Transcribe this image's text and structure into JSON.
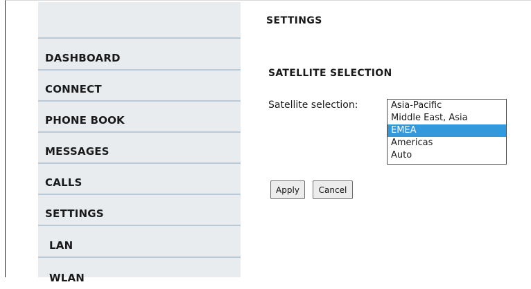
{
  "sidebar": {
    "items": [
      {
        "label": "DASHBOARD"
      },
      {
        "label": "CONNECT"
      },
      {
        "label": "PHONE BOOK"
      },
      {
        "label": "MESSAGES"
      },
      {
        "label": "CALLS"
      },
      {
        "label": "SETTINGS"
      },
      {
        "label": "LAN"
      },
      {
        "label": "WLAN"
      }
    ]
  },
  "main": {
    "title": "SETTINGS",
    "section_title": "SATELLITE SELECTION",
    "field_label": "Satellite selection:",
    "options": [
      "Asia-Pacific",
      "Middle East, Asia",
      "EMEA",
      "Americas",
      "Auto"
    ],
    "selected_option": "EMEA",
    "selected_color": "#3399dd",
    "apply_label": "Apply",
    "cancel_label": "Cancel"
  }
}
